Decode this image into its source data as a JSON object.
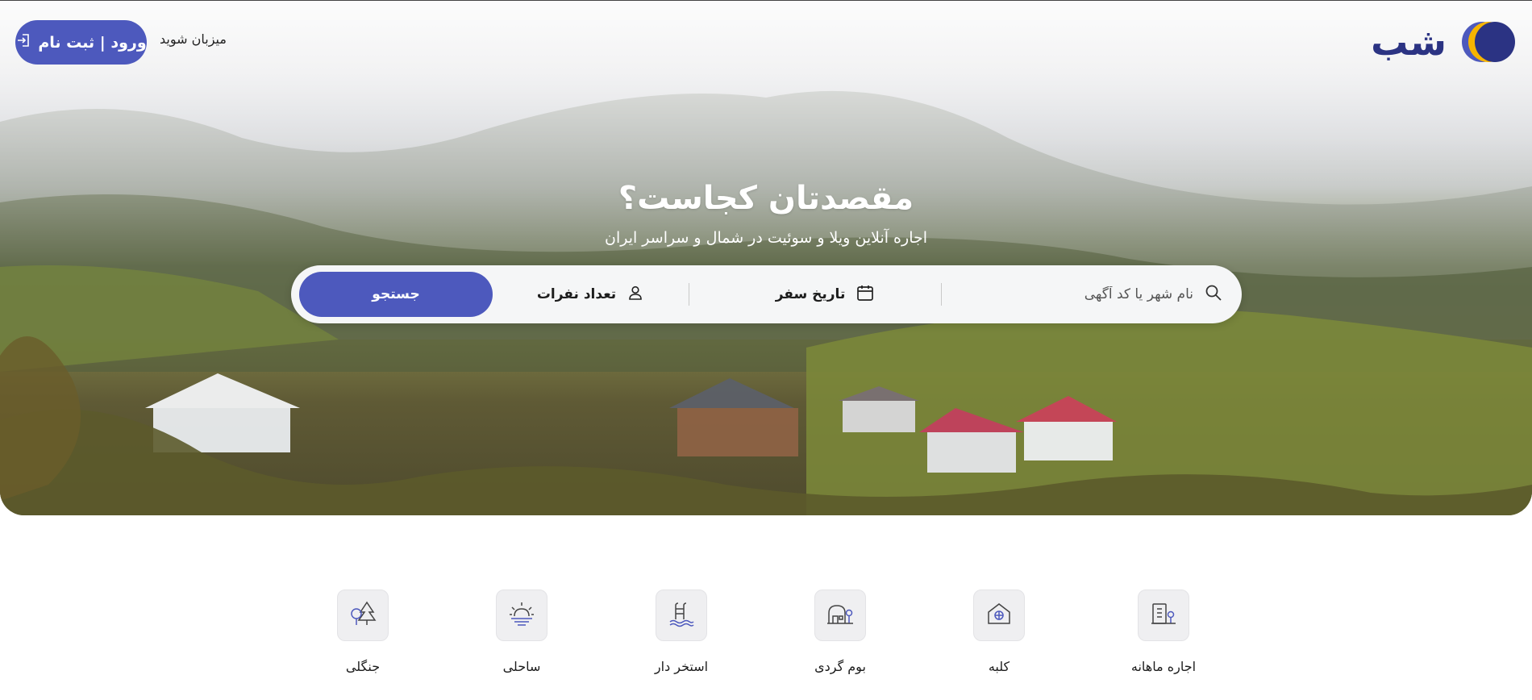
{
  "brand": {
    "logo_text": "شب",
    "logo_colors": [
      "#2b3383",
      "#f6b400",
      "#4d59bd"
    ]
  },
  "header": {
    "auth_button_label": "ورود | ثبت نام",
    "host_link_label": "میزبان شوید"
  },
  "hero": {
    "title": "مقصدتان کجاست؟",
    "subtitle": "اجاره آنلاین ویلا و سوئیت در شمال و سراسر ایران"
  },
  "search": {
    "city_placeholder": "نام شهر یا کد آگهی",
    "date_label": "تاریخ سفر",
    "guests_label": "تعداد نفرات",
    "submit_label": "جستجو"
  },
  "categories": [
    {
      "label": "اجاره ماهانه",
      "icon": "building-tree-icon"
    },
    {
      "label": "کلبه",
      "icon": "cabin-icon"
    },
    {
      "label": "بوم گردی",
      "icon": "ecolodge-icon"
    },
    {
      "label": "استخر دار",
      "icon": "pool-icon"
    },
    {
      "label": "ساحلی",
      "icon": "sunrise-beach-icon"
    },
    {
      "label": "جنگلی",
      "icon": "forest-icon"
    }
  ],
  "colors": {
    "accent": "#4d59bd",
    "brand_dark": "#2b3383",
    "brand_yellow": "#f6b400"
  }
}
